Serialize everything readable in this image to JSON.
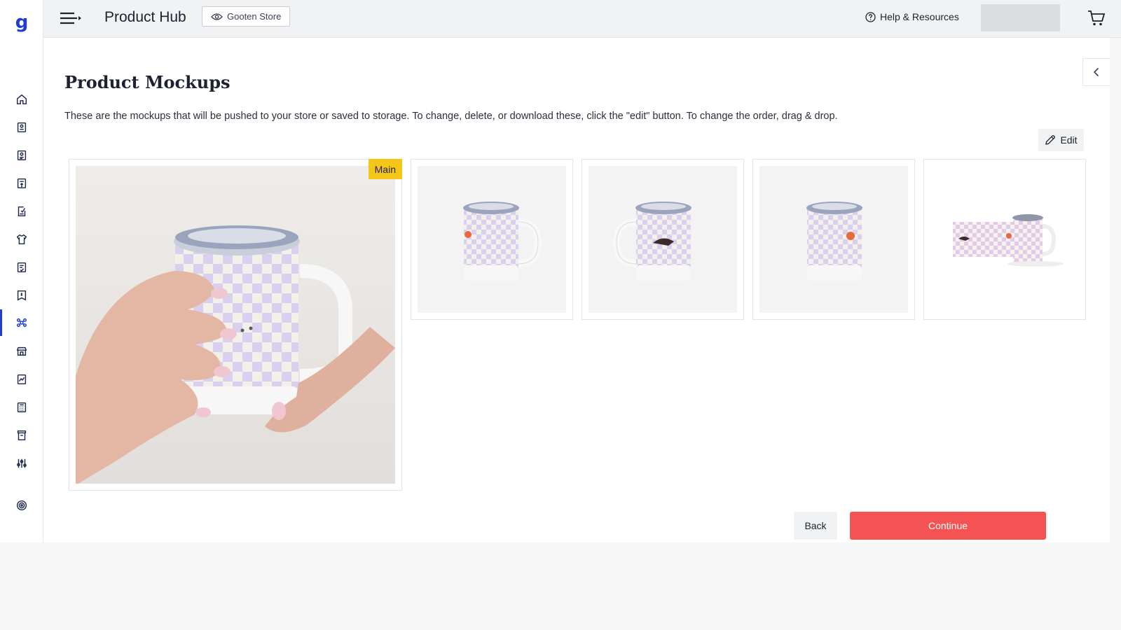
{
  "colors": {
    "accent": "#1f3bd1",
    "primary_button": "#f55353",
    "main_badge": "#f5c518",
    "mug_check": "#d9cfee"
  },
  "sidebar": {
    "logo": "g",
    "items": [
      {
        "icon": "home-icon"
      },
      {
        "icon": "orders-icon"
      },
      {
        "icon": "order-list-icon"
      },
      {
        "icon": "upload-icon"
      },
      {
        "icon": "returns-icon"
      },
      {
        "icon": "tshirt-icon"
      },
      {
        "icon": "checklist-icon"
      },
      {
        "icon": "billing-icon"
      },
      {
        "icon": "product-hub-icon",
        "active": true
      },
      {
        "icon": "store-icon"
      },
      {
        "icon": "reports-icon"
      },
      {
        "icon": "calculator-icon"
      },
      {
        "icon": "archive-icon"
      },
      {
        "icon": "settings-sliders-icon"
      },
      {
        "icon": "target-icon"
      }
    ]
  },
  "header": {
    "title": "Product Hub",
    "store_name": "Gooten Store",
    "help_label": "Help & Resources"
  },
  "page": {
    "title": "Product Mockups",
    "description": "These are the mockups that will be pushed to your store or saved to storage. To change, delete, or download these, click the \"edit\" button. To change the order, drag & drop.",
    "edit_label": "Edit",
    "main_badge": "Main",
    "back_label": "Back",
    "continue_label": "Continue"
  }
}
